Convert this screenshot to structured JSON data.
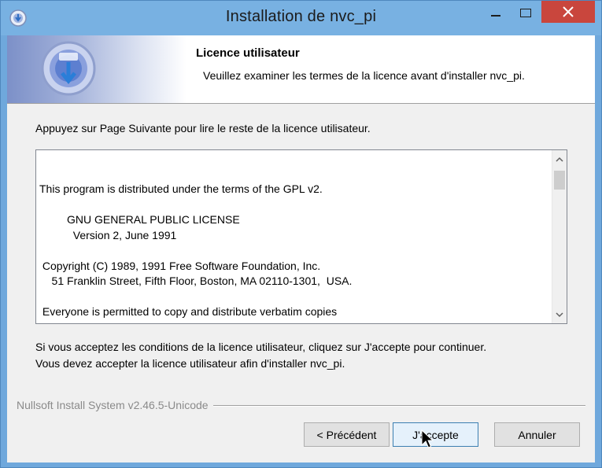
{
  "window": {
    "title": "Installation de nvc_pi"
  },
  "header": {
    "title": "Licence utilisateur",
    "subtitle": "Veuillez examiner les termes de la licence avant d'installer nvc_pi."
  },
  "page": {
    "intro": "Appuyez sur Page Suivante pour lire le reste de la licence utilisateur.",
    "license_text": "This program is distributed under the terms of the GPL v2.\n\n         GNU GENERAL PUBLIC LICENSE\n           Version 2, June 1991\n\n Copyright (C) 1989, 1991 Free Software Foundation, Inc.\n    51 Franklin Street, Fifth Floor, Boston, MA 02110-1301,  USA.\n\n Everyone is permitted to copy and distribute verbatim copies",
    "accept_line1": "Si vous acceptez les conditions de la licence utilisateur, cliquez sur J'accepte pour continuer.",
    "accept_line2": "Vous devez accepter la licence utilisateur afin d'installer nvc_pi."
  },
  "branding": "Nullsoft Install System v2.46.5-Unicode",
  "buttons": {
    "back": "< Précédent",
    "accept": "J'accepte",
    "cancel": "Annuler"
  },
  "icons": {
    "app": "installer-app-icon",
    "header": "installer-header-icon",
    "minimize": "minimize-icon",
    "maximize": "maximize-icon",
    "close": "close-icon",
    "scroll_up": "chevron-up-icon",
    "scroll_down": "chevron-down-icon",
    "cursor": "mouse-pointer-icon"
  },
  "colors": {
    "titlebar": "#78b1e2",
    "close_button": "#c9463d",
    "default_button_border": "#3c7fb1"
  }
}
